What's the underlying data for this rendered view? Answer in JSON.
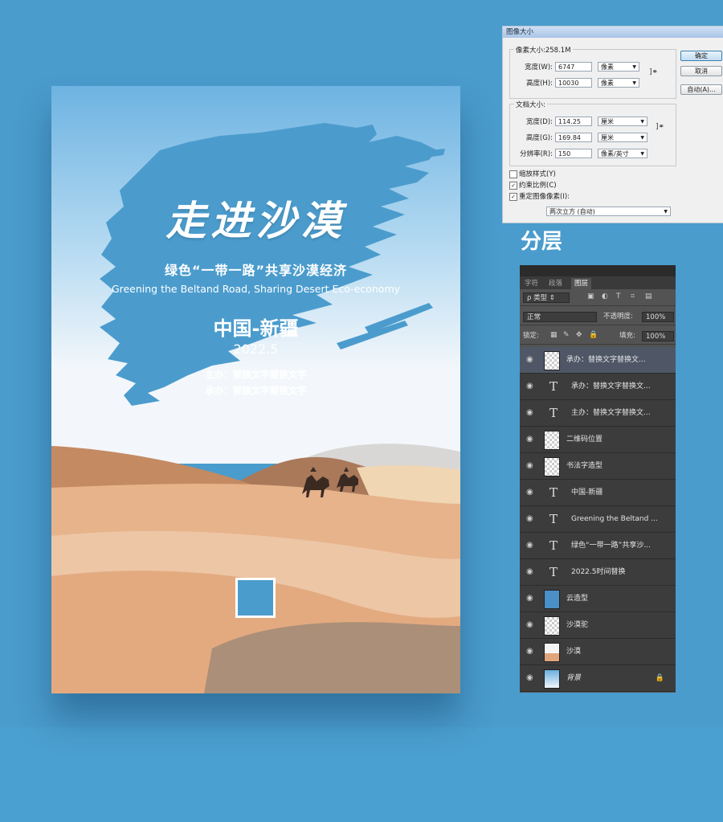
{
  "poster": {
    "title": "走进沙漠",
    "subtitle_cn": "绿色“一带一路”共享沙漠经济",
    "subtitle_en": "Greening the Beltand Road, Sharing Desert Eco-economy",
    "region": "中国-新疆",
    "date": "2022.5",
    "organizer": "主办：替换文字替换文字",
    "undertaker": "承办：替换文字替换文字"
  },
  "image_size_dialog": {
    "title": "图像大小",
    "pixel_size_label": "像素大小:258.1M",
    "width_label": "宽度(W):",
    "width_value": "6747",
    "width_unit": "像素",
    "height_label": "高度(H):",
    "height_value": "10030",
    "height_unit": "像素",
    "doc_size_label": "文档大小:",
    "doc_width_label": "宽度(D):",
    "doc_width_value": "114.25",
    "doc_width_unit": "厘米",
    "doc_height_label": "高度(G):",
    "doc_height_value": "169.84",
    "doc_height_unit": "厘米",
    "resolution_label": "分辨率(R):",
    "resolution_value": "150",
    "resolution_unit": "像素/英寸",
    "ok_button": "确定",
    "cancel_button": "取消",
    "auto_button": "自动(A)...",
    "scale_styles": "缩放样式(Y)",
    "constrain_proportions": "约束比例(C)",
    "resample": "重定图像像素(I):",
    "resample_method": "两次立方 (自动)"
  },
  "layers_heading": "分层",
  "layers_panel": {
    "tabs": [
      "字符",
      "段落",
      "图层"
    ],
    "active_tab": "图层",
    "filter_kind": "类型",
    "blend_mode": "正常",
    "opacity_label": "不透明度:",
    "opacity_value": "100%",
    "lock_label": "锁定:",
    "fill_label": "填充:",
    "fill_value": "100%",
    "layers": [
      {
        "name": "承办：替换文字替换文...",
        "type": "image",
        "selected": true
      },
      {
        "name": "承办：替换文字替换文...",
        "type": "text"
      },
      {
        "name": "主办：替换文字替换文...",
        "type": "text"
      },
      {
        "name": "二维码位置",
        "type": "image"
      },
      {
        "name": "书法字造型",
        "type": "image"
      },
      {
        "name": "中国-新疆",
        "type": "text"
      },
      {
        "name": "Greening the Beltand ...",
        "type": "text"
      },
      {
        "name": "绿色“一带一路”共享沙...",
        "type": "text"
      },
      {
        "name": "2022.5时间替换",
        "type": "text"
      },
      {
        "name": "云造型",
        "type": "image"
      },
      {
        "name": "沙漠驼",
        "type": "image"
      },
      {
        "name": "沙漠",
        "type": "image"
      },
      {
        "name": "背景",
        "type": "image",
        "locked": true
      }
    ]
  }
}
